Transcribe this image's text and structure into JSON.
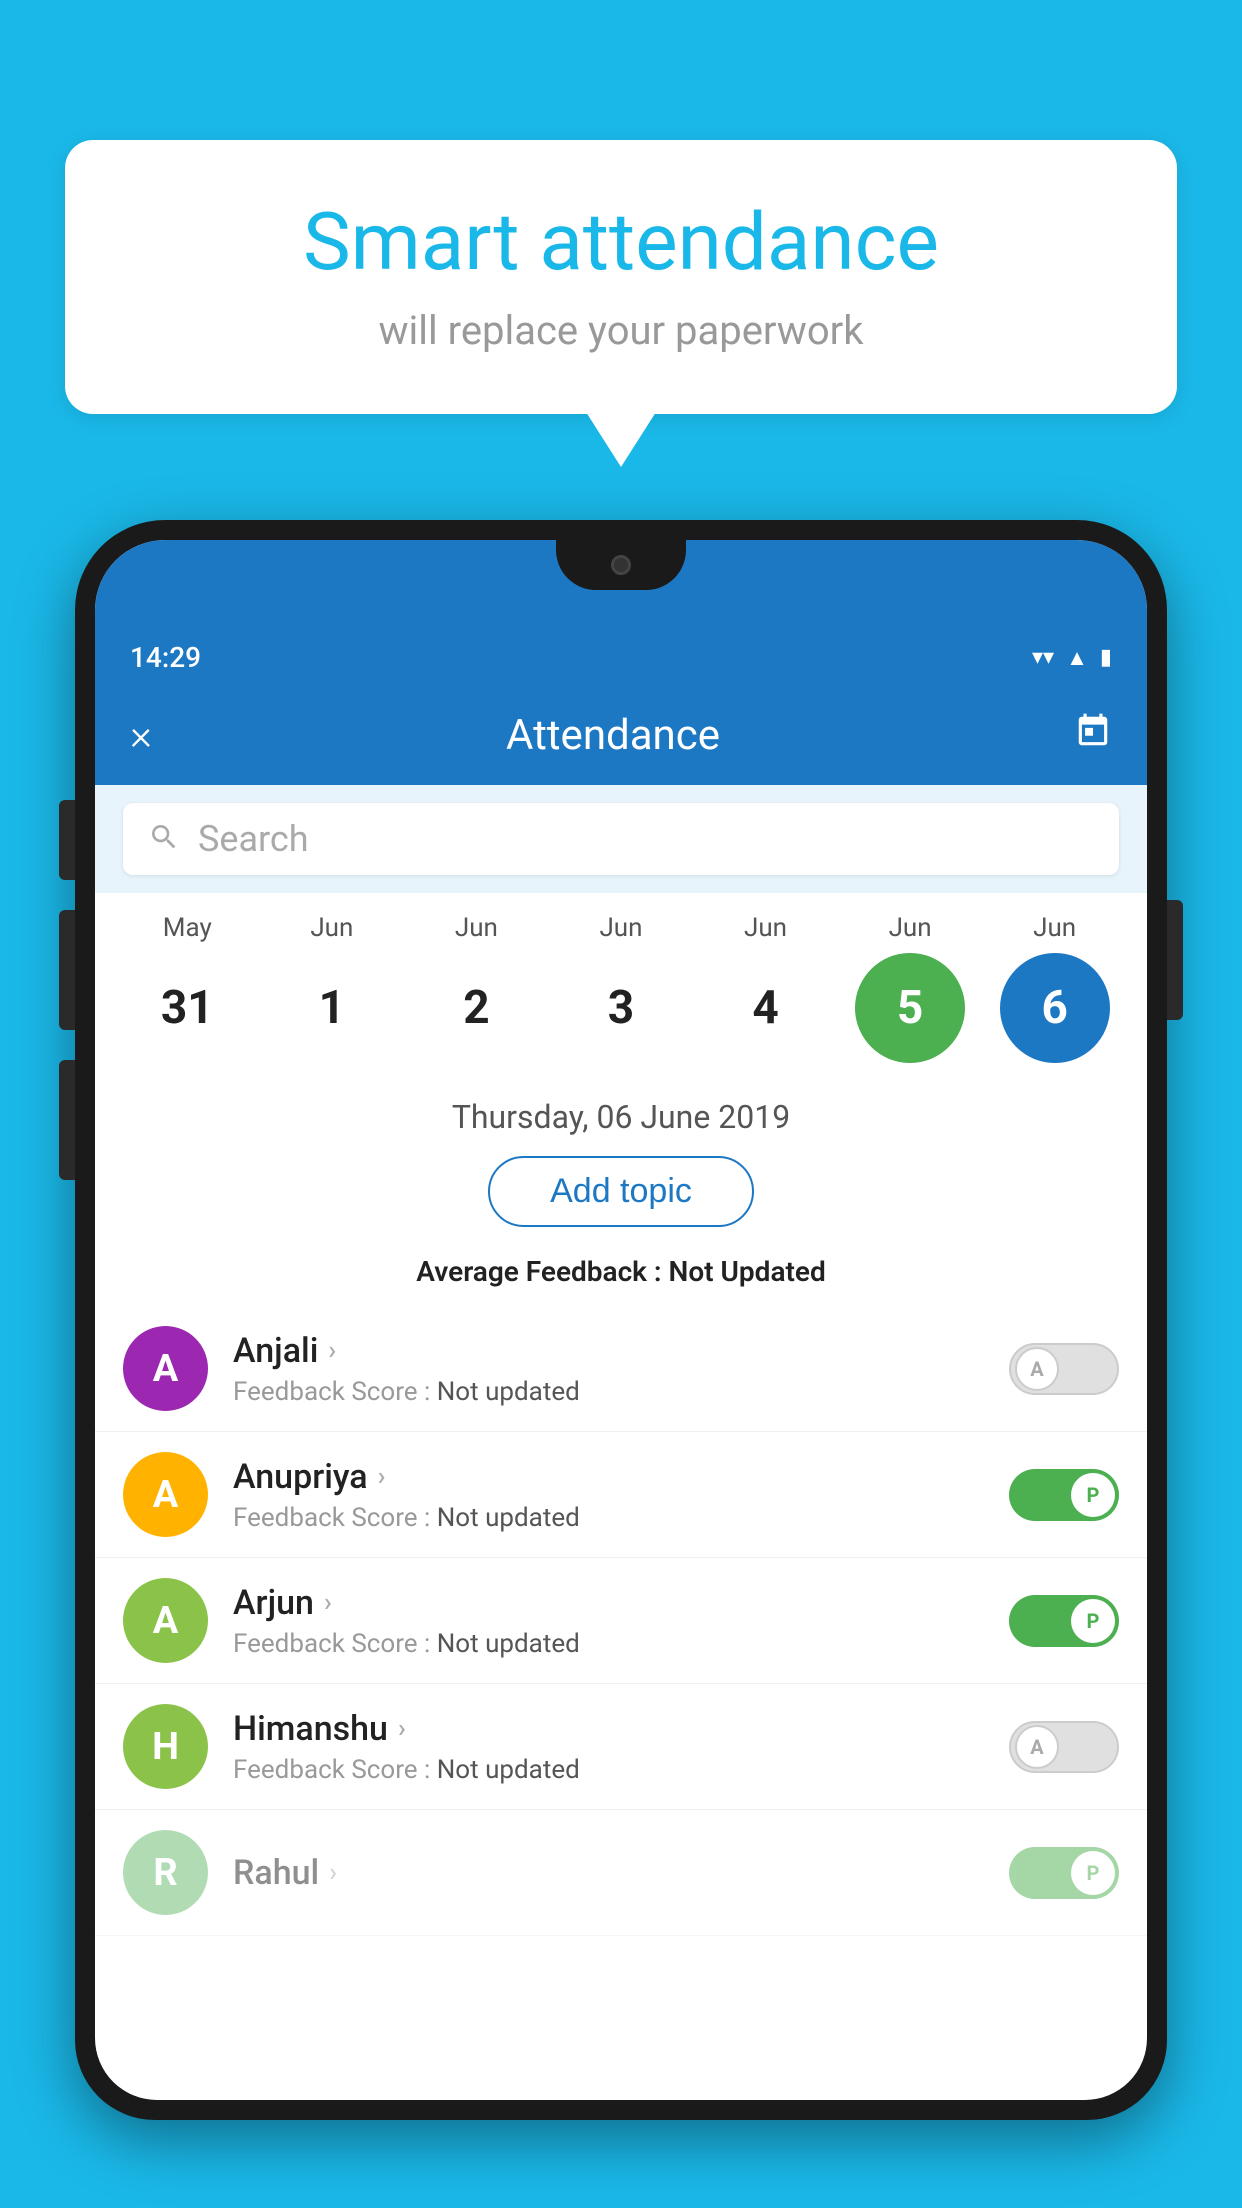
{
  "background_color": "#1ab8e8",
  "speech_bubble": {
    "title": "Smart attendance",
    "subtitle": "will replace your paperwork"
  },
  "phone": {
    "status_bar": {
      "time": "14:29",
      "icons": [
        "wifi",
        "signal",
        "battery"
      ]
    },
    "toolbar": {
      "close_label": "×",
      "title": "Attendance",
      "calendar_icon": "calendar"
    },
    "search": {
      "placeholder": "Search"
    },
    "calendar": {
      "months": [
        "May",
        "Jun",
        "Jun",
        "Jun",
        "Jun",
        "Jun",
        "Jun"
      ],
      "dates": [
        "31",
        "1",
        "2",
        "3",
        "4",
        "5",
        "6"
      ],
      "today_index": 5,
      "selected_index": 6
    },
    "selected_date_label": "Thursday, 06 June 2019",
    "add_topic_label": "Add topic",
    "feedback_label": "Average Feedback : ",
    "feedback_value": "Not Updated",
    "students": [
      {
        "name": "Anjali",
        "avatar_letter": "A",
        "avatar_color": "#9c27b0",
        "feedback_label": "Feedback Score : ",
        "feedback_value": "Not updated",
        "toggle_state": "off",
        "toggle_label": "A"
      },
      {
        "name": "Anupriya",
        "avatar_letter": "A",
        "avatar_color": "#ffb300",
        "feedback_label": "Feedback Score : ",
        "feedback_value": "Not updated",
        "toggle_state": "on",
        "toggle_label": "P"
      },
      {
        "name": "Arjun",
        "avatar_letter": "A",
        "avatar_color": "#8bc34a",
        "feedback_label": "Feedback Score : ",
        "feedback_value": "Not updated",
        "toggle_state": "on",
        "toggle_label": "P"
      },
      {
        "name": "Himanshu",
        "avatar_letter": "H",
        "avatar_color": "#8bc34a",
        "feedback_label": "Feedback Score : ",
        "feedback_value": "Not updated",
        "toggle_state": "off",
        "toggle_label": "A"
      }
    ]
  }
}
